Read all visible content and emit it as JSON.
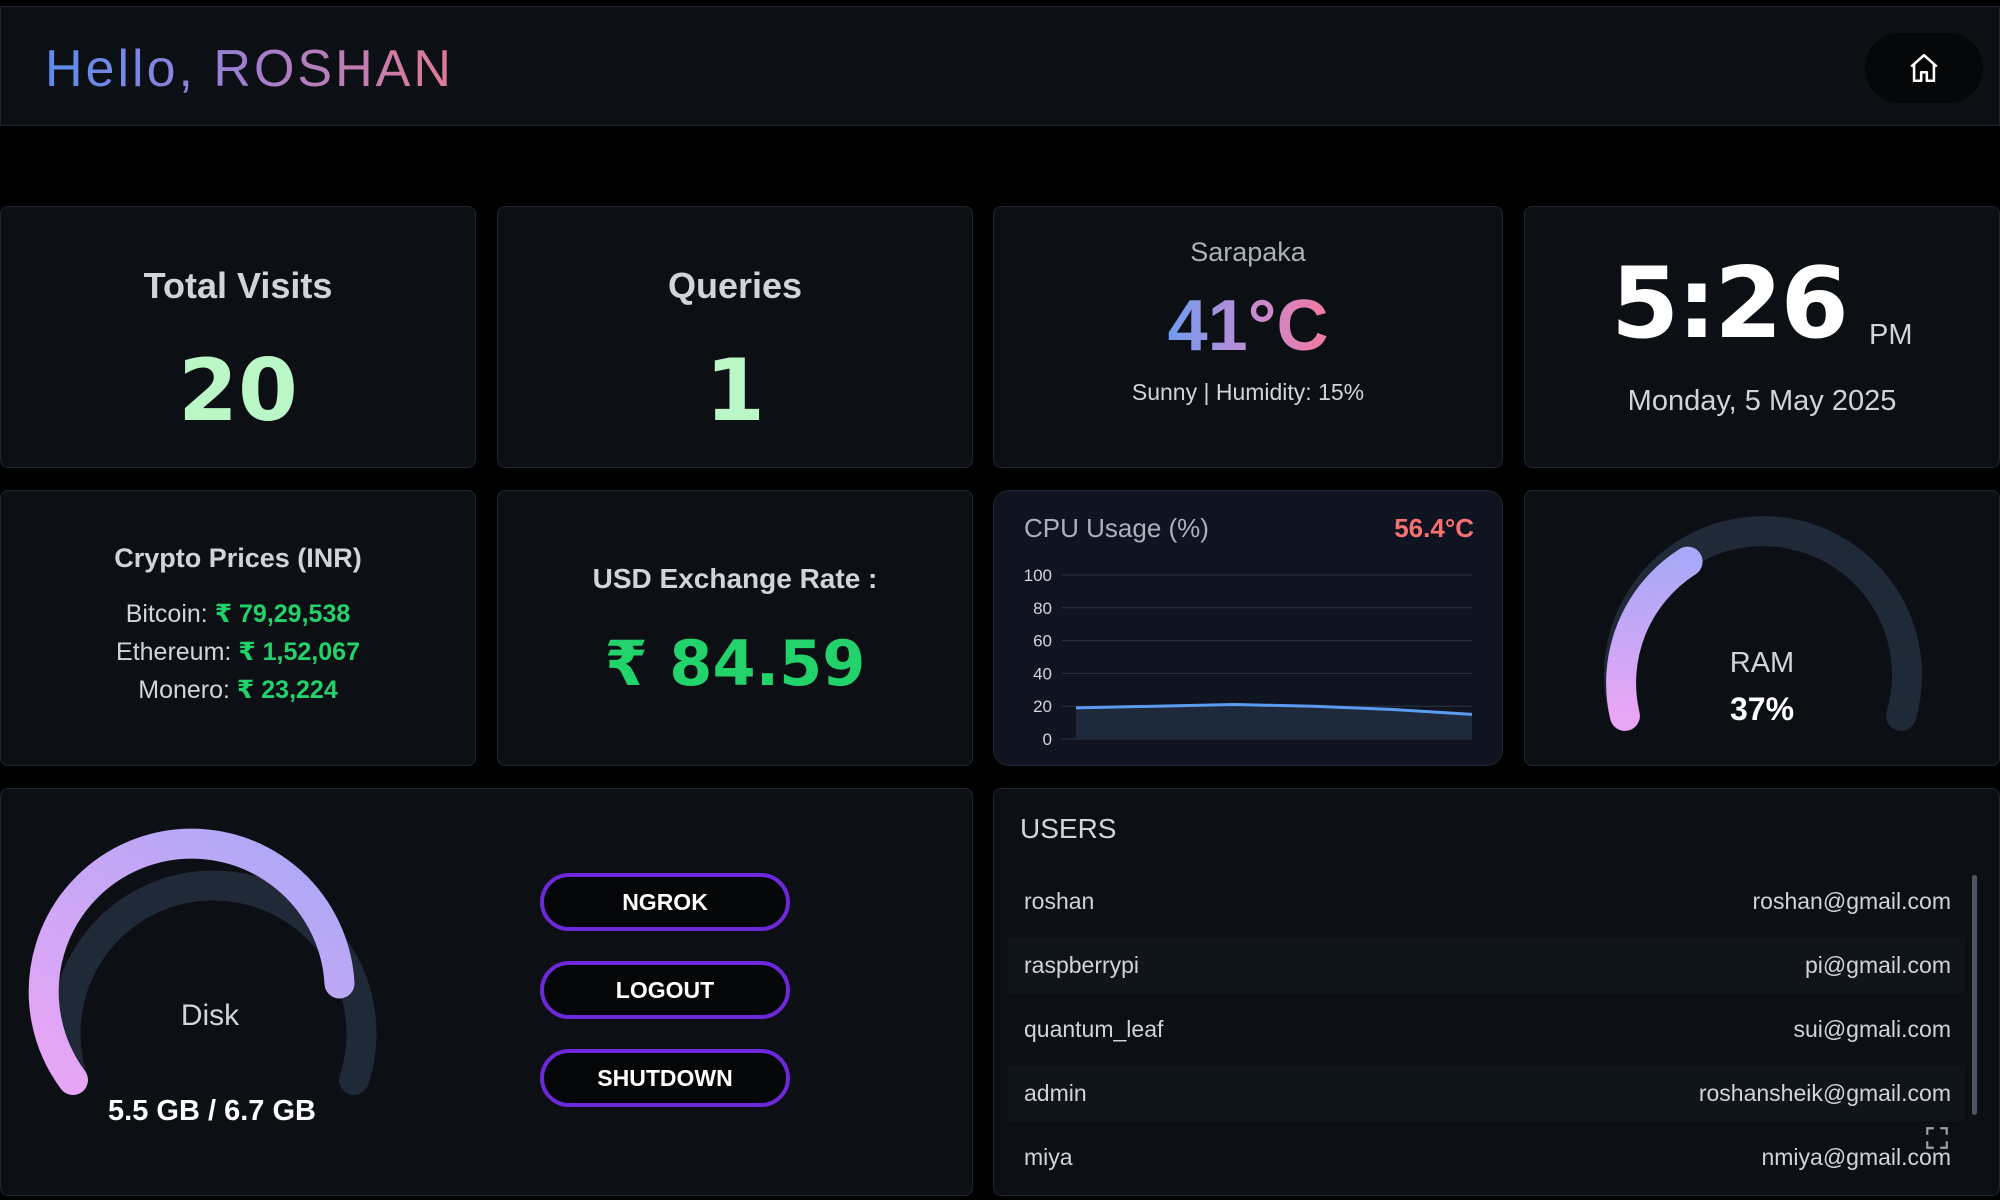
{
  "header": {
    "greeting": "Hello, ROSHAN",
    "home_icon": "home-icon"
  },
  "stats": {
    "visits": {
      "title": "Total Visits",
      "value": "20"
    },
    "queries": {
      "title": "Queries",
      "value": "1"
    }
  },
  "weather": {
    "location": "Sarapaka",
    "temperature": "41°C",
    "details": "Sunny | Humidity: 15%"
  },
  "clock": {
    "time": "5:26",
    "ampm": "PM",
    "date": "Monday, 5 May 2025"
  },
  "crypto": {
    "title": "Crypto Prices (INR)",
    "items": [
      {
        "label": "Bitcoin:",
        "value": "₹ 79,29,538"
      },
      {
        "label": "Ethereum:",
        "value": "₹ 1,52,067"
      },
      {
        "label": "Monero:",
        "value": "₹ 23,224"
      }
    ]
  },
  "exchange": {
    "title": "USD Exchange Rate :",
    "value": "₹ 84.59"
  },
  "cpu": {
    "title": "CPU Usage (%)",
    "temperature": "56.4°C",
    "chart_data": {
      "type": "area",
      "y_ticks": [
        "100",
        "80",
        "60",
        "40",
        "20",
        "0"
      ],
      "ylim": [
        0,
        100
      ],
      "values": [
        19,
        20,
        21,
        20,
        18,
        15
      ]
    }
  },
  "ram": {
    "label": "RAM",
    "value": "37%",
    "percent": 37
  },
  "disk": {
    "label": "Disk",
    "value": "5.5 GB / 6.7 GB",
    "percent": 82
  },
  "actions": {
    "ngrok": "NGROK",
    "logout": "LOGOUT",
    "shutdown": "SHUTDOWN"
  },
  "users": {
    "title": "USERS",
    "rows": [
      {
        "name": "roshan",
        "email": "roshan@gmail.com"
      },
      {
        "name": "raspberrypi",
        "email": "pi@gmail.com"
      },
      {
        "name": "quantum_leaf",
        "email": "sui@gmali.com"
      },
      {
        "name": "admin",
        "email": "roshansheik@gmail.com"
      },
      {
        "name": "miya",
        "email": "nmiya@gmail.com"
      }
    ]
  },
  "colors": {
    "accent_green": "#22d36b",
    "button_border": "#6d28d9",
    "temp_red": "#f87171"
  }
}
